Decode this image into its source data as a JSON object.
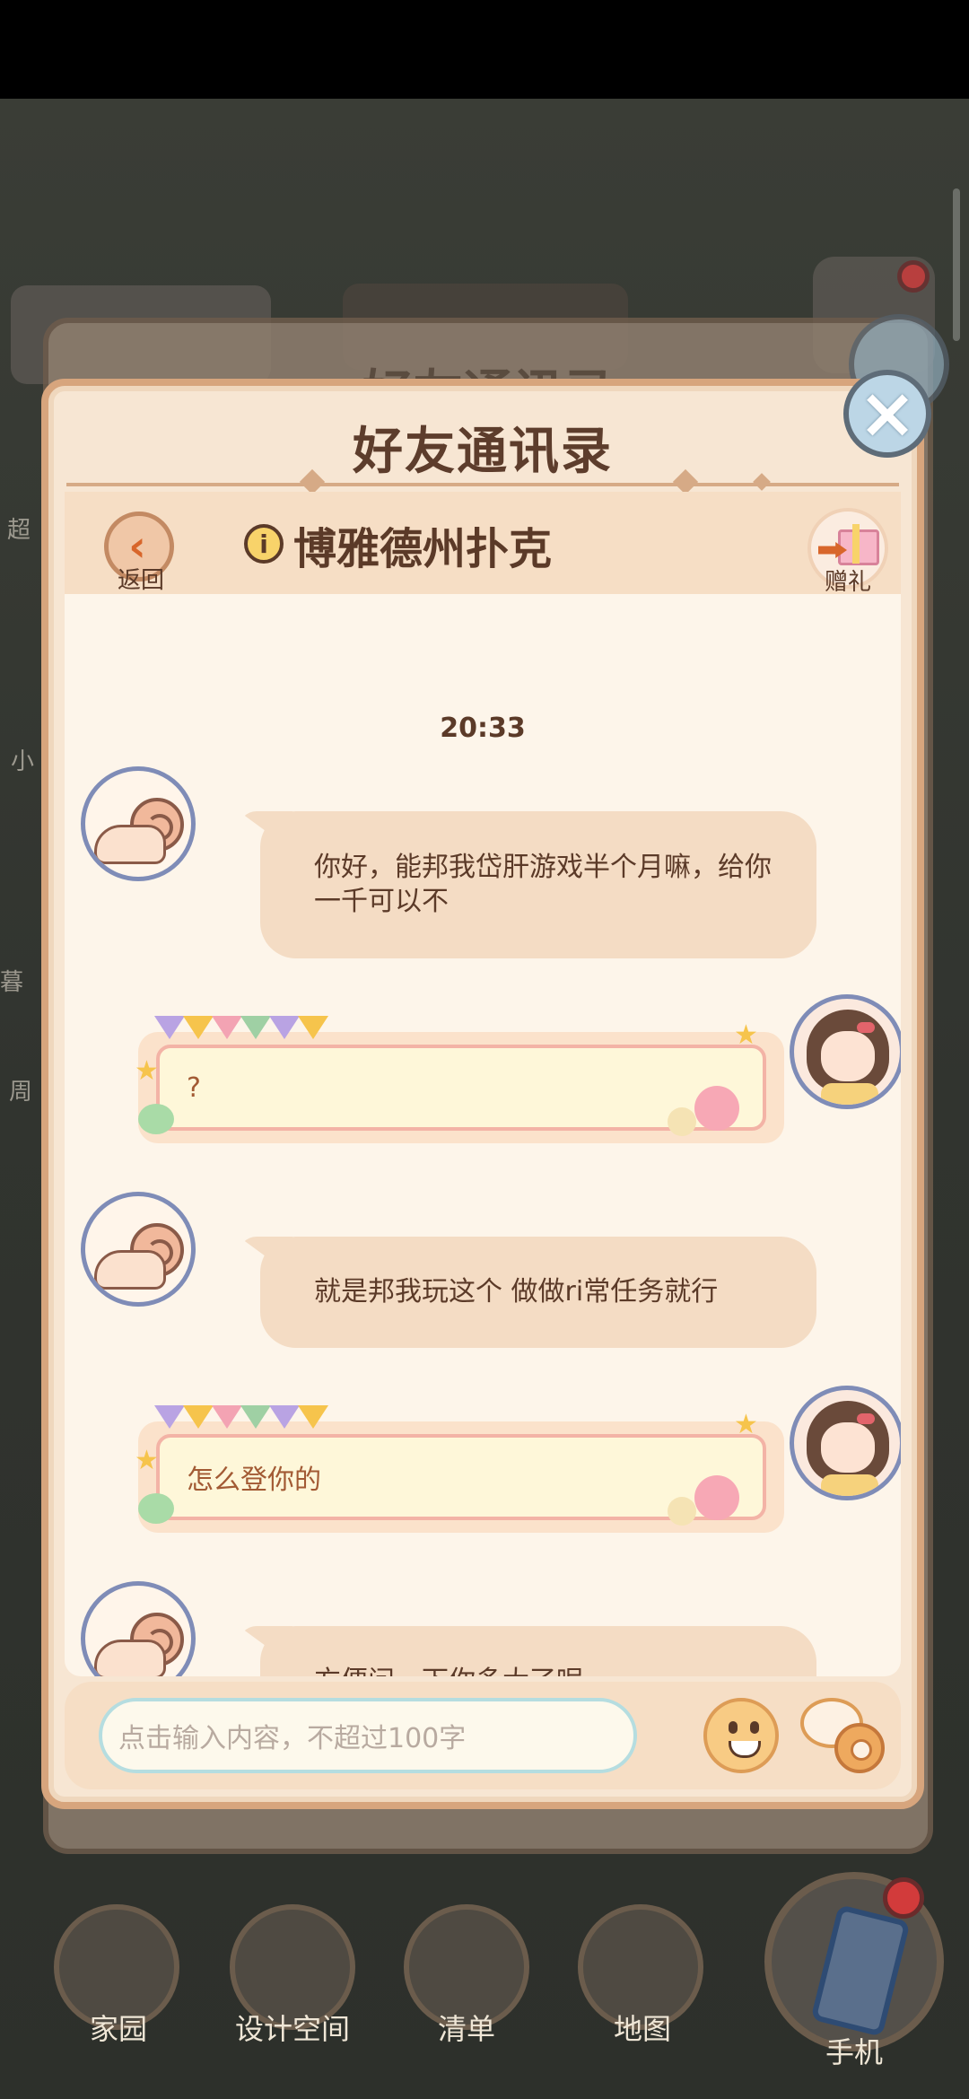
{
  "dialog": {
    "title": "好友通讯录",
    "back_dialog_title": "好友通讯录"
  },
  "chat_header": {
    "back_label": "返回",
    "friend_name": "博雅德州扑克",
    "gift_label": "赠礼"
  },
  "timestamp": "20:33",
  "messages": [
    {
      "sender": "friend",
      "text": "你好，能邦我岱肝游戏半个月嘛，给你一千可以不"
    },
    {
      "sender": "me",
      "text": "?"
    },
    {
      "sender": "friend",
      "text": "就是邦我玩这个  做做ri常任务就行"
    },
    {
      "sender": "me",
      "text": "怎么登你的"
    },
    {
      "sender": "friend",
      "text": "方便问一下你多大了呢"
    }
  ],
  "input": {
    "placeholder": "点击输入内容，不超过100字"
  },
  "bottom_nav": [
    {
      "label": "家园",
      "icon": "home-icon"
    },
    {
      "label": "设计空间",
      "icon": "design-icon"
    },
    {
      "label": "清单",
      "icon": "list-icon"
    },
    {
      "label": "地图",
      "icon": "map-pin-icon"
    },
    {
      "label": "手机",
      "icon": "phone-icon"
    }
  ],
  "background_hints": {
    "left_texts": [
      "超",
      "小",
      "暮",
      "周"
    ]
  },
  "colors": {
    "dialog_bg": "#f7e6d3",
    "incoming_bubble": "#f4dcc4",
    "outgoing_bubble_text": "#a25a34",
    "title_text": "#5d3d2c"
  }
}
